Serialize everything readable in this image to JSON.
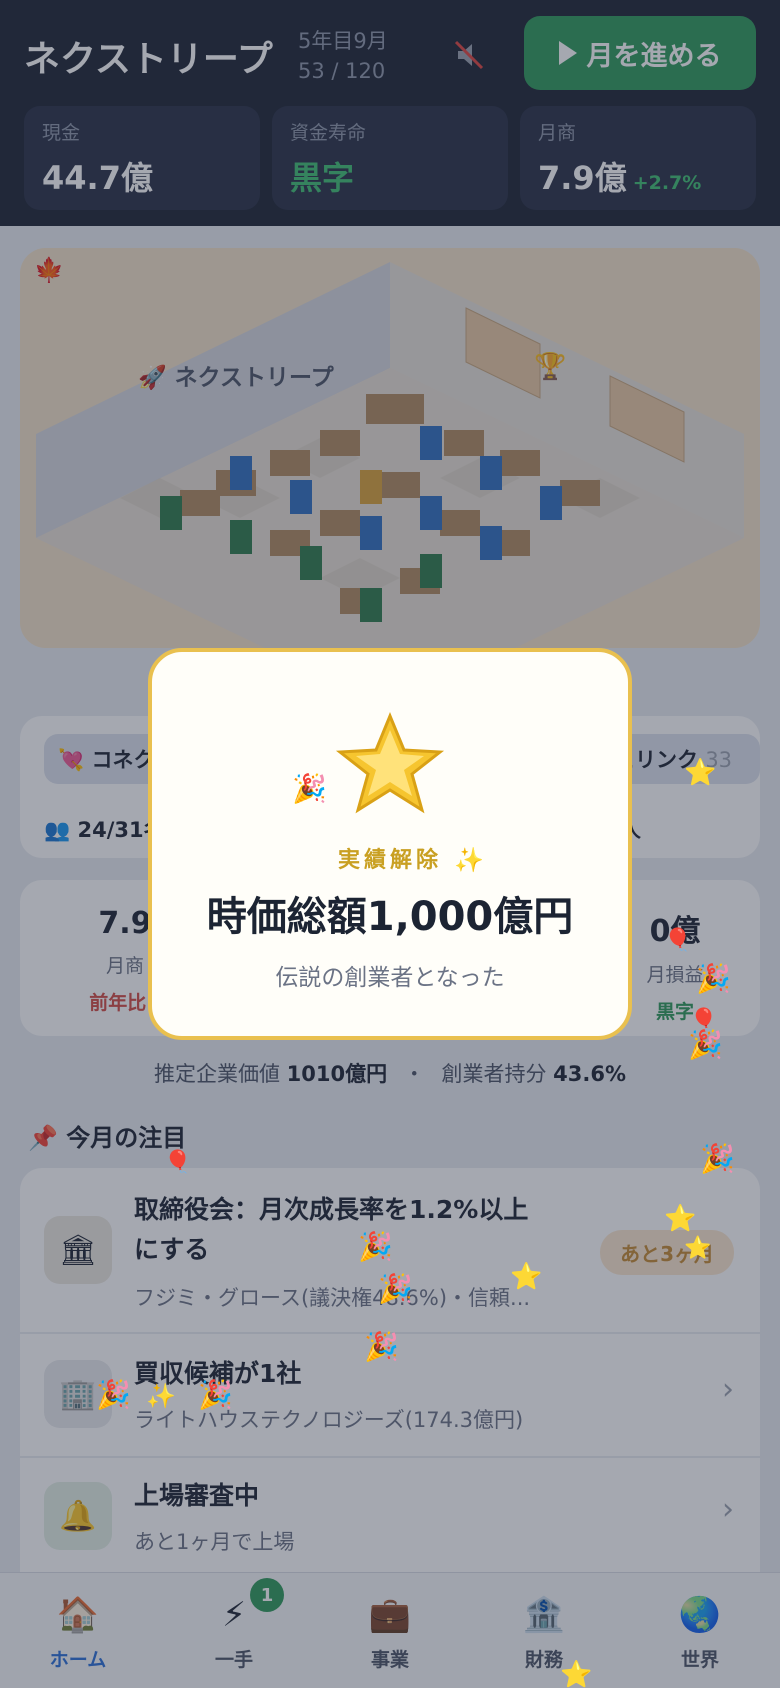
{
  "header": {
    "company": "ネクストリープ",
    "period_line1": "5年目9月",
    "period_line2": "53 / 120",
    "advance_label": "月を進める",
    "stats": [
      {
        "label": "現金",
        "value": "44.7億",
        "change": ""
      },
      {
        "label": "資金寿命",
        "value": "黒字",
        "change": ""
      },
      {
        "label": "月商",
        "value": "7.9億",
        "change": "+2.7%"
      }
    ]
  },
  "office": {
    "name": "ネクストリープ",
    "name_icon": "rocket-icon",
    "season_icon": "maple-leaf-icon",
    "trophy_icon": "trophy-icon"
  },
  "pills": {
    "left_partial": "コネク",
    "right_partial": "ェリンク",
    "right_count_partial": "33"
  },
  "members": {
    "text": "24/31名",
    "right_partial": "人"
  },
  "kpis": {
    "left_value_partial": "7.9",
    "left_label_partial": "月商",
    "left_sub_partial": "前年比 -",
    "right_value_partial": "0億",
    "right_label_partial": "月損益",
    "right_sub_partial": "黒字"
  },
  "valuation": {
    "label1": "推定企業価値",
    "value1": "1010億円",
    "sep": "・",
    "label2": "創業者持分",
    "value2": "43.6%"
  },
  "focus": {
    "title": "今月の注目",
    "items": [
      {
        "icon": "courthouse-icon",
        "title_line1": "取締役会：月次成長率を1.2%以上",
        "title_line2": "にする",
        "sub": "フジミ・グロース(議決権48.6%)・信頼...",
        "badge": "あと3ヶ月"
      },
      {
        "icon": "office-building-icon",
        "title_line1": "買収候補が1社",
        "title_line2": "",
        "sub": "ライトハウステクノロジーズ(174.3億円)",
        "badge": ""
      },
      {
        "icon": "bell-icon",
        "title_line1": "上場審査中",
        "title_line2": "",
        "sub": "あと1ヶ月で上場",
        "badge": ""
      }
    ]
  },
  "tabs": [
    {
      "label": "ホーム",
      "icon": "house-icon"
    },
    {
      "label": "一手",
      "icon": "lightning-icon",
      "badge": "1"
    },
    {
      "label": "事業",
      "icon": "briefcase-icon"
    },
    {
      "label": "財務",
      "icon": "bank-icon"
    },
    {
      "label": "世界",
      "icon": "globe-icon"
    }
  ],
  "modal": {
    "kicker": "実績解除",
    "title": "時価総額1,000億円",
    "description": "伝説の創業者となった"
  },
  "colors": {
    "header_bg": "#1c2333",
    "accent_green": "#2e9a5a",
    "gold": "#e9c04f",
    "active_tab": "#2a6ed8"
  }
}
